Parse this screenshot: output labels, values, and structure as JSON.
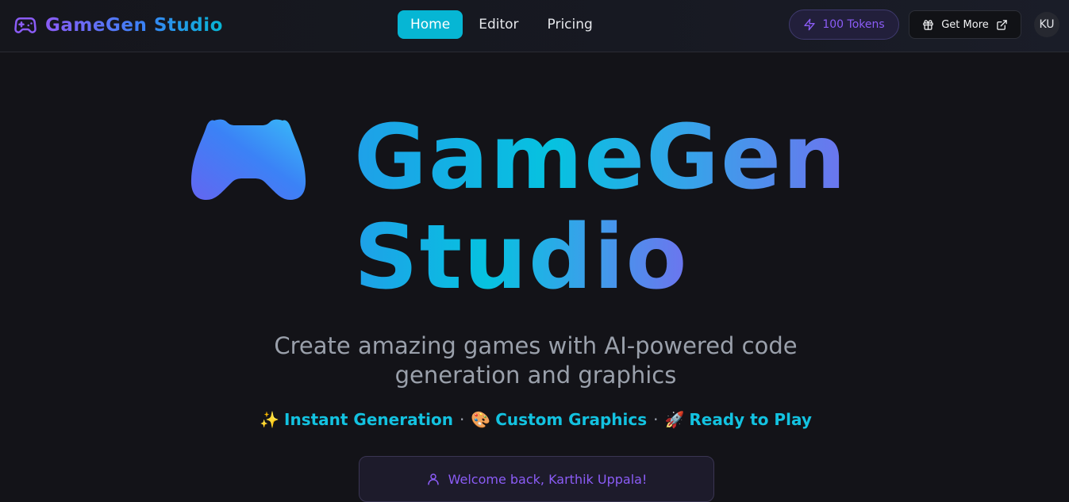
{
  "nav": {
    "brand": "GameGen Studio",
    "links": [
      {
        "label": "Home",
        "active": true
      },
      {
        "label": "Editor",
        "active": false
      },
      {
        "label": "Pricing",
        "active": false
      }
    ],
    "tokens_label": "100 Tokens",
    "get_more_label": "Get More",
    "avatar_initials": "KU"
  },
  "hero": {
    "title_line1": "GameGen",
    "title_line2": "Studio",
    "subtitle_line1": "Create amazing games with AI-powered code",
    "subtitle_line2": "generation and graphics",
    "features": [
      {
        "emoji": "✨",
        "label": "Instant Generation"
      },
      {
        "emoji": "🎨",
        "label": "Custom Graphics"
      },
      {
        "emoji": "🚀",
        "label": "Ready to Play"
      }
    ],
    "separator": "·",
    "welcome": "Welcome back, Karthik Uppala!"
  },
  "icons": {
    "brand": "gamepad-icon",
    "tokens": "lightning-icon",
    "get_more": "gift-icon",
    "external": "external-link-icon",
    "welcome": "user-icon"
  },
  "colors": {
    "accent_cyan": "#06b6d4",
    "accent_purple": "#8b5cf6",
    "background": "#131318"
  }
}
